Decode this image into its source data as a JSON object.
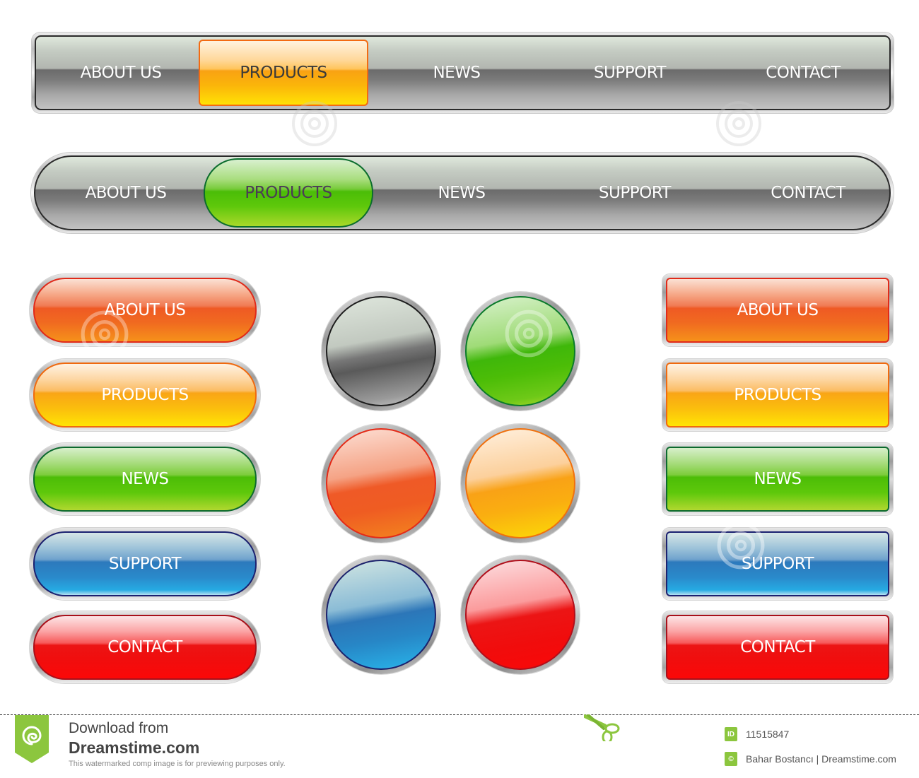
{
  "nav_bar_rectangular": {
    "items": [
      {
        "label": "ABOUT US",
        "active": false
      },
      {
        "label": "PRODUCTS",
        "active": true,
        "active_color": "#f9a516"
      },
      {
        "label": "NEWS",
        "active": false
      },
      {
        "label": "SUPPORT",
        "active": false
      },
      {
        "label": "CONTACT",
        "active": false
      }
    ]
  },
  "nav_bar_rounded": {
    "items": [
      {
        "label": "ABOUT US",
        "active": false
      },
      {
        "label": "PRODUCTS",
        "active": true,
        "active_color": "#4cbd07"
      },
      {
        "label": "NEWS",
        "active": false
      },
      {
        "label": "SUPPORT",
        "active": false
      },
      {
        "label": "CONTACT",
        "active": false
      }
    ]
  },
  "pill_buttons": [
    {
      "label": "ABOUT US",
      "color": "#ef5a24"
    },
    {
      "label": "PRODUCTS",
      "color": "#f9a516"
    },
    {
      "label": "NEWS",
      "color": "#4cbd07"
    },
    {
      "label": "SUPPORT",
      "color": "#2c79bc"
    },
    {
      "label": "CONTACT",
      "color": "#ec1414"
    }
  ],
  "round_buttons": [
    {
      "name": "gray",
      "color": "#5a5a5a"
    },
    {
      "name": "green",
      "color": "#4cbd07"
    },
    {
      "name": "red-orange",
      "color": "#ef5a27"
    },
    {
      "name": "orange",
      "color": "#f9a216"
    },
    {
      "name": "blue",
      "color": "#2c76b8"
    },
    {
      "name": "red",
      "color": "#ec1515"
    }
  ],
  "rect_buttons": [
    {
      "label": "ABOUT US",
      "color": "#ef5a24"
    },
    {
      "label": "PRODUCTS",
      "color": "#f9a516"
    },
    {
      "label": "NEWS",
      "color": "#4cbd07"
    },
    {
      "label": "SUPPORT",
      "color": "#2c79bc"
    },
    {
      "label": "CONTACT",
      "color": "#ec1414"
    }
  ],
  "watermark": {
    "text": "dreamstime"
  },
  "footer": {
    "download_line1": "Download from",
    "download_line2": "Dreamstime.com",
    "disclaimer": "This watermarked comp image is for previewing purposes only.",
    "id_icon_label": "ID",
    "image_id": "11515847",
    "copyright_icon_label": "©",
    "credit": "Bahar Bostancı | Dreamstime.com",
    "brand_color": "#8cc63e"
  }
}
